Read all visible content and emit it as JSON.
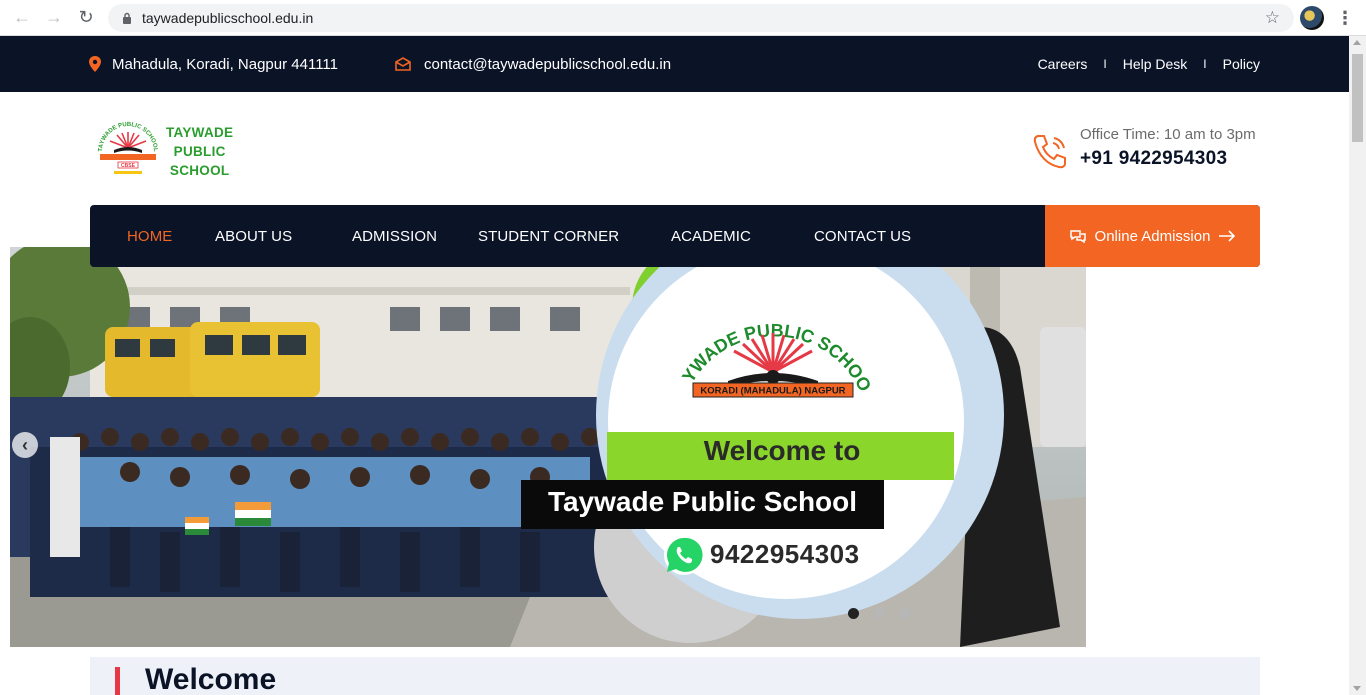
{
  "browser": {
    "url": "taywadepublicschool.edu.in"
  },
  "topbar": {
    "address": "Mahadula, Koradi, Nagpur 441111",
    "email": "contact@taywadepublicschool.edu.in",
    "links": [
      "Careers",
      "Help Desk",
      "Policy"
    ],
    "separator": "I"
  },
  "header": {
    "logo_text": [
      "TAYWADE",
      "PUBLIC",
      "SCHOOL"
    ],
    "office_time": "Office Time: 10 am to 3pm",
    "phone": "+91 9422954303"
  },
  "nav": {
    "items": [
      {
        "label": "HOME",
        "active": true,
        "dropdown": false
      },
      {
        "label": "ABOUT US",
        "active": false,
        "dropdown": true
      },
      {
        "label": "ADMISSION",
        "active": false,
        "dropdown": false
      },
      {
        "label": "STUDENT CORNER",
        "active": false,
        "dropdown": true
      },
      {
        "label": "ACADEMIC",
        "active": false,
        "dropdown": true
      },
      {
        "label": "CONTACT US",
        "active": false,
        "dropdown": false
      }
    ],
    "cta": "Online Admission"
  },
  "hero": {
    "badge_arc": "TAYWADE PUBLIC SCHOOL",
    "badge_sub": "KORADI (MAHADULA) NAGPUR",
    "welcome_to": "Welcome to",
    "school_name": "Taywade Public School",
    "whatsapp_number": "9422954303",
    "slide_count": 3,
    "active_slide": 0
  },
  "welcome": {
    "title": "Welcome"
  },
  "colors": {
    "navy": "#0b1327",
    "orange": "#f26522",
    "green": "#8bd62a",
    "whatsapp": "#25d366"
  }
}
